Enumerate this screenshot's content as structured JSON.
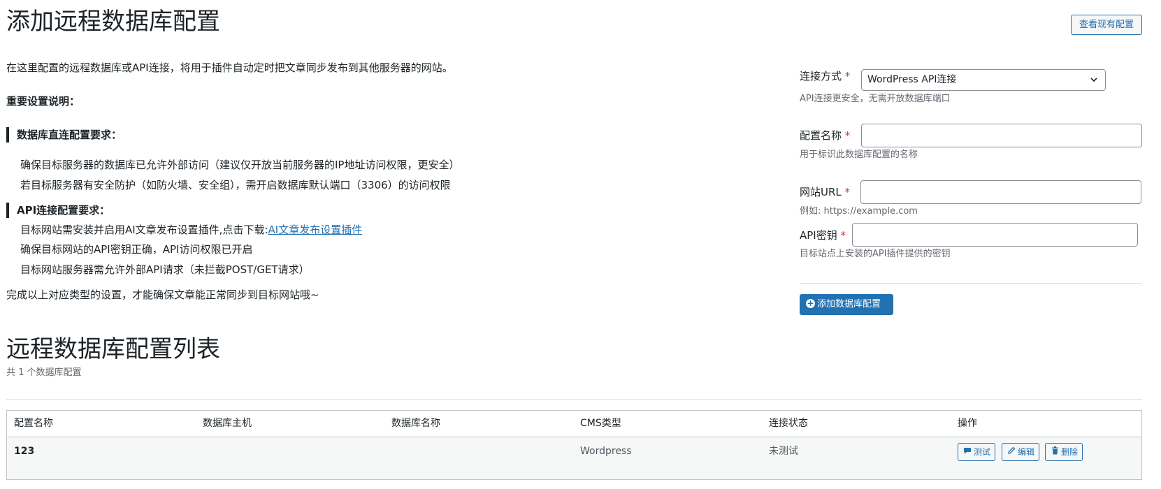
{
  "header": {
    "title": "添加远程数据库配置",
    "view_button": "查看现有配置"
  },
  "intro": {
    "description": "在这里配置的远程数据库或API连接，将用于插件自动定时把文章同步发布到其他服务器的网站。",
    "important_title": "重要设置说明：",
    "db_section": {
      "title": "数据库直连配置要求：",
      "items": [
        "确保目标服务器的数据库已允许外部访问（建议仅开放当前服务器的IP地址访问权限，更安全）",
        "若目标服务器有安全防护（如防火墙、安全组），需开启数据库默认端口（3306）的访问权限"
      ]
    },
    "api_section": {
      "title": "API连接配置要求：",
      "item1_prefix": "目标网站需安装并启用AI文章发布设置插件,点击下载:",
      "item1_link": "AI文章发布设置插件",
      "item2": "确保目标网站的API密钥正确，API访问权限已开启",
      "item3": "目标网站服务器需允许外部API请求（未拦截POST/GET请求）"
    },
    "footer_note": "完成以上对应类型的设置，才能确保文章能正常同步到目标网站哦~"
  },
  "form": {
    "connection": {
      "label": "连接方式",
      "required": "*",
      "value": "WordPress API连接",
      "hint": "API连接更安全，无需开放数据库端口"
    },
    "config_name": {
      "label": "配置名称",
      "required": "*",
      "value": "",
      "hint": "用于标识此数据库配置的名称"
    },
    "site_url": {
      "label": "网站URL",
      "required": "*",
      "value": "",
      "hint": "例如: https://example.com"
    },
    "api_key": {
      "label": "API密钥",
      "required": "*",
      "value": "",
      "hint": "目标站点上安装的API插件提供的密钥"
    },
    "submit_label": "添加数据库配置"
  },
  "list": {
    "title": "远程数据库配置列表",
    "count_text": "共 1 个数据库配置",
    "columns": [
      "配置名称",
      "数据库主机",
      "数据库名称",
      "CMS类型",
      "连接状态",
      "操作"
    ],
    "rows": [
      {
        "name": "123",
        "host": "",
        "db_name": "",
        "cms": "Wordpress",
        "status": "未测试",
        "actions": {
          "test": "测试",
          "edit": "编辑",
          "delete": "删除"
        }
      }
    ]
  },
  "colors": {
    "accent": "#2271b1",
    "required": "#d63638"
  },
  "icons": {
    "submit": "plus-circle-icon",
    "test": "comment-icon",
    "edit": "pencil-icon",
    "delete": "trash-icon"
  }
}
